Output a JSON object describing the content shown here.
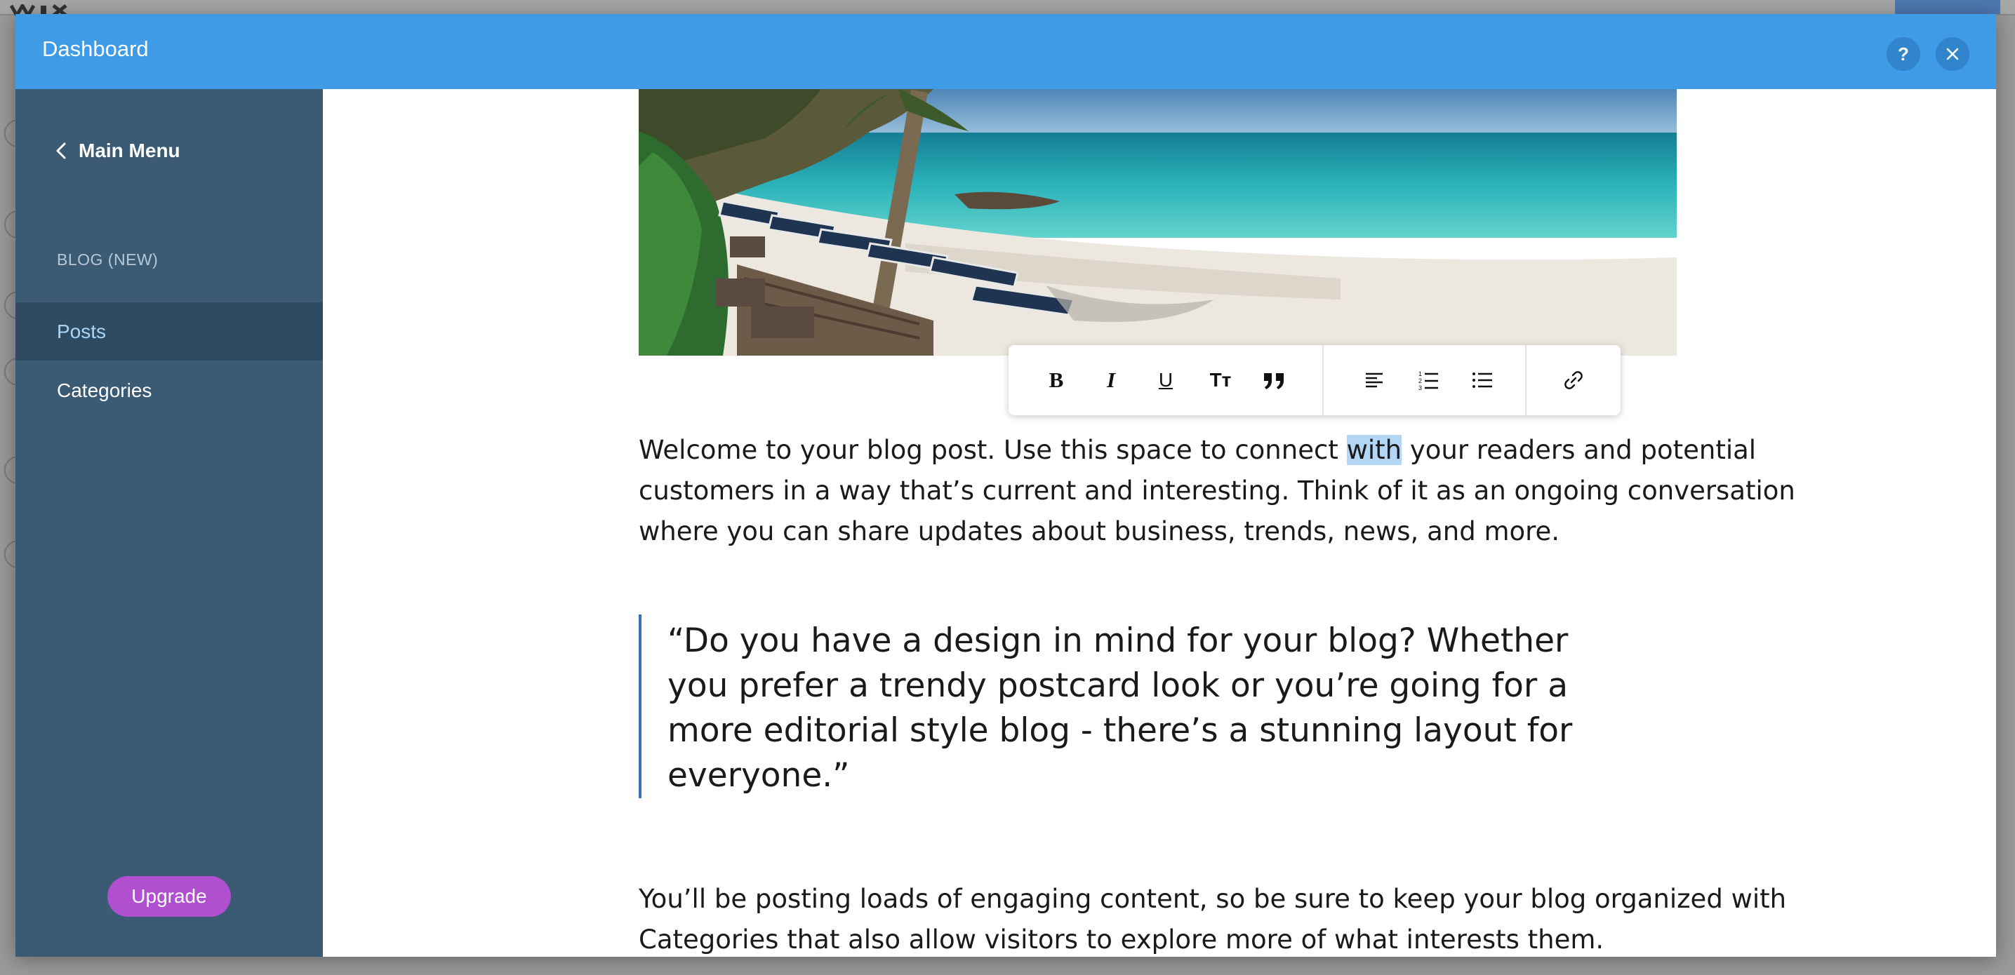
{
  "modal": {
    "title": "Dashboard",
    "help_label": "?"
  },
  "sidebar": {
    "main_menu_label": "Main Menu",
    "section_label": "BLOG (NEW)",
    "items": [
      {
        "label": "Posts",
        "active": true
      },
      {
        "label": "Categories",
        "active": false
      }
    ],
    "upgrade_label": "Upgrade"
  },
  "toolbar": {
    "groups": [
      [
        "bold-icon",
        "italic-icon",
        "underline-icon",
        "text-size-icon",
        "quote-icon"
      ],
      [
        "align-left-icon",
        "numbered-list-icon",
        "bulleted-list-icon"
      ],
      [
        "link-icon"
      ]
    ],
    "bold": "B",
    "italic": "I",
    "underline": "U",
    "text_size": "Tт"
  },
  "post": {
    "paragraph1": {
      "line1_before": "Welcome to your blog post. Use this space to connect ",
      "line1_selected": "with",
      "line1_after": " your readers and potential",
      "line2": "customers in a way that’s current and interesting. Think of it as an ongoing conversation",
      "line3": "where you can share updates about business, trends, news, and more."
    },
    "quote_lines": [
      "“Do you have a design in mind for your blog? Whether",
      "you prefer a trendy postcard look or you’re going for a",
      "more editorial style blog - there’s a stunning layout for",
      "everyone.”"
    ],
    "paragraph2_lines": [
      "You’ll be posting loads of engaging content, so be sure to keep your blog organized with",
      "Categories that also allow visitors to explore more of what interests them."
    ]
  },
  "colors": {
    "header": "#3f9be6",
    "sidebar": "#3b5a73",
    "sidebar_active": "#2f4b62",
    "upgrade": "#b04fd0",
    "quote_border": "#3a6fc4",
    "selection": "#b4d6f6"
  }
}
